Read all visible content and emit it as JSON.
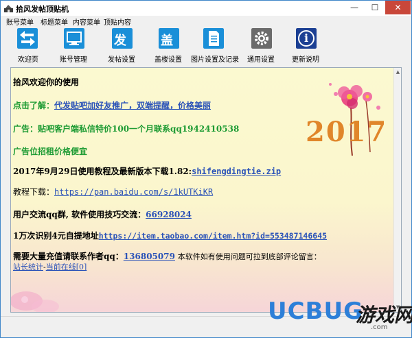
{
  "window": {
    "title": "拾风发帖顶贴机",
    "controls": {
      "minimize": "—",
      "maximize": "☐",
      "close": "✕"
    }
  },
  "menu": [
    {
      "label": "账号菜单"
    },
    {
      "label": "标题菜单"
    },
    {
      "label": "内容菜单"
    },
    {
      "label": "顶贴内容"
    }
  ],
  "toolbar": [
    {
      "label": "欢迎页",
      "icon": "swap-arrows-icon",
      "color": "#1a8fd8"
    },
    {
      "label": "账号管理",
      "icon": "monitor-icon",
      "color": "#1a8fd8"
    },
    {
      "label": "发帖设置",
      "icon": "post-icon",
      "glyph": "发",
      "color": "#1a8fd8"
    },
    {
      "label": "盖楼设置",
      "icon": "reply-icon",
      "glyph": "盖",
      "color": "#1a8fd8"
    },
    {
      "label": "图片设置及记录",
      "icon": "document-icon",
      "color": "#1a8fd8"
    },
    {
      "label": "通用设置",
      "icon": "gear-icon",
      "color": "#6b6b6b"
    },
    {
      "label": "更新说明",
      "icon": "info-icon",
      "glyph": "i",
      "color": "#1b3f93"
    }
  ],
  "content": {
    "welcome": "拾风欢迎你的使用",
    "ad1_prefix": "点击了解：",
    "ad1_link": "代发贴吧加好友推广，双端提醒，价格美丽",
    "ad2": "广告：贴吧客户端私信特价100一个月联系qq1942410538",
    "ad3": "广告位招租价格便宜",
    "release_prefix": "2017年9月29日使用教程及最新版本下载1.82:",
    "release_link": "shifengdingtie.zip",
    "tutorial_prefix": "教程下载：",
    "tutorial_link": "https://pan.baidu.com/s/1kUTKiKR",
    "qq_group_prefix": "用户交流qq群, 软件使用技巧交流：",
    "qq_group_link": "66928024",
    "captcha_prefix": "1万次识别4元自提地址",
    "captcha_link": "https://item.taobao.com/item.htm?id=553487146645",
    "contact_prefix": "需要大量充值请联系作者qq：",
    "contact_qq": "136805079",
    "contact_suffix": "本软件如有使用问题可拉到底部评论留言：",
    "stats_link": "站长统计",
    "stats_sep": "-",
    "online_link": "当前在线[0]",
    "year_art": "2017"
  },
  "watermark": {
    "brand": "UCBUG",
    "cn": "游戏网",
    "sub": ".com"
  },
  "colors": {
    "accent_blue": "#1a8fd8",
    "ad_green": "#1d9b33",
    "link_blue": "#2a52b8",
    "close_red": "#c9473a"
  }
}
